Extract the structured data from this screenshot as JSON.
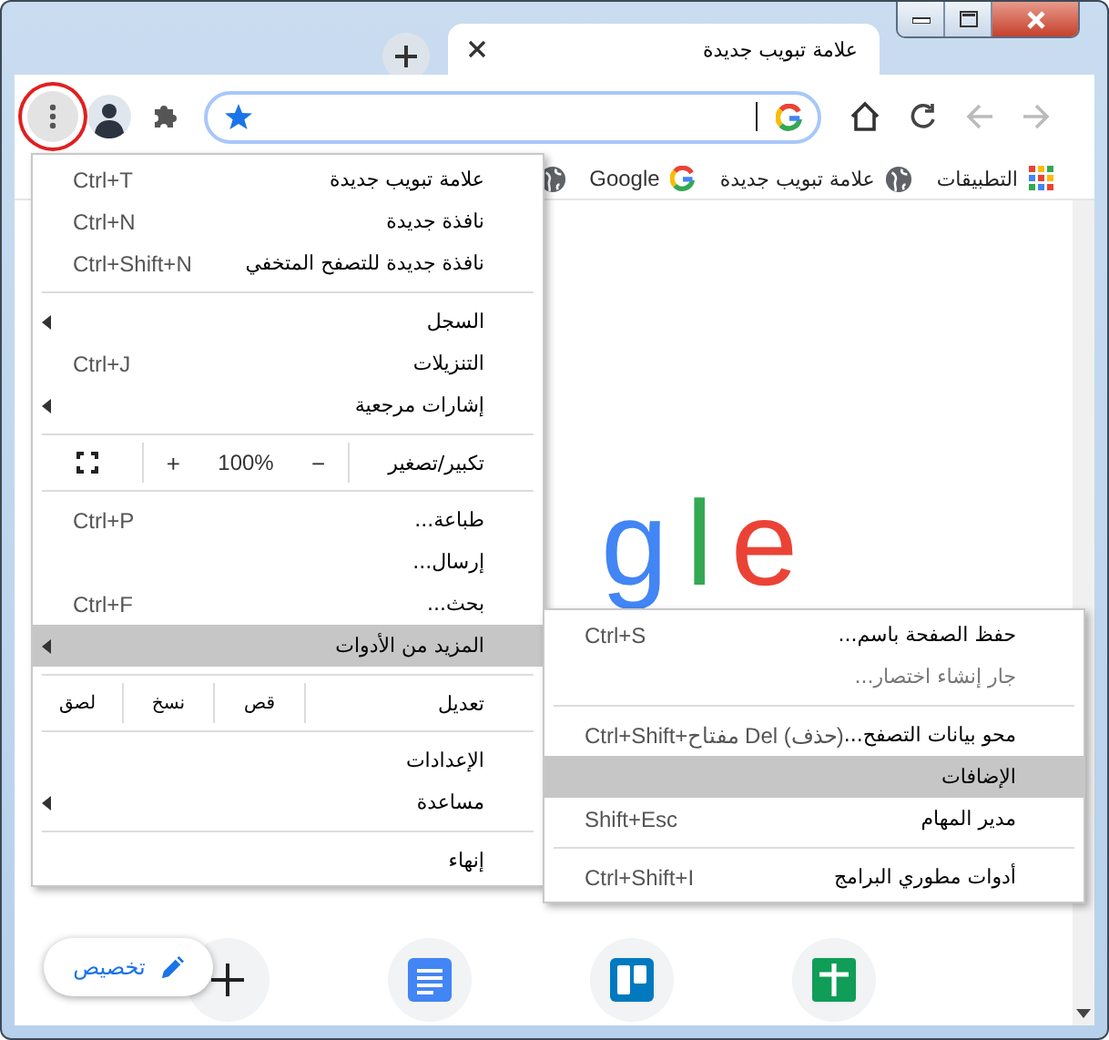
{
  "tabs": [
    {
      "title": "علامة تبويب جديدة",
      "selected": true
    }
  ],
  "toolbar": {
    "menu_button_outlined": true,
    "back_disabled": true,
    "forward_disabled": true
  },
  "bookmarks": [
    {
      "kind": "apps",
      "label": "التطبيقات"
    },
    {
      "kind": "globe",
      "label": "علامة تبويب جديدة"
    },
    {
      "kind": "g",
      "label": "Google"
    },
    {
      "kind": "globe"
    }
  ],
  "logo": {
    "text": "gle"
  },
  "shortcuts": [
    {
      "kind": "add"
    },
    {
      "kind": "docs"
    },
    {
      "kind": "board"
    },
    {
      "kind": "sheet"
    }
  ],
  "customize_button": {
    "label": "تخصيص"
  },
  "main_menu": {
    "items": [
      {
        "kind": "item",
        "label": "علامة تبويب جديدة",
        "shortcut": "Ctrl+T",
        "submenu": false,
        "selected": false
      },
      {
        "kind": "item",
        "label": "نافذة جديدة",
        "shortcut": "Ctrl+N",
        "submenu": false,
        "selected": false
      },
      {
        "kind": "item",
        "label": "نافذة جديدة للتصفح المتخفي",
        "shortcut": "Ctrl+Shift+N",
        "submenu": false,
        "selected": false
      },
      {
        "kind": "separator"
      },
      {
        "kind": "item",
        "label": "السجل",
        "submenu": true,
        "selected": false
      },
      {
        "kind": "item",
        "label": "التنزيلات",
        "shortcut": "Ctrl+J",
        "submenu": false,
        "selected": false
      },
      {
        "kind": "item",
        "label": "إشارات مرجعية",
        "submenu": true,
        "selected": false
      },
      {
        "kind": "separator"
      },
      {
        "kind": "zoom",
        "label": "تكبير/تصغير",
        "minus": "−",
        "value": "100%",
        "plus": "+"
      },
      {
        "kind": "separator"
      },
      {
        "kind": "item",
        "label": "طباعة...",
        "shortcut": "Ctrl+P",
        "submenu": false,
        "selected": false
      },
      {
        "kind": "item",
        "label": "إرسال...",
        "submenu": false,
        "selected": false
      },
      {
        "kind": "item",
        "label": "بحث...",
        "shortcut": "Ctrl+F",
        "submenu": false,
        "selected": false
      },
      {
        "kind": "item",
        "label": "المزيد من الأدوات",
        "submenu": true,
        "selected": true
      },
      {
        "kind": "separator"
      },
      {
        "kind": "edit",
        "label": "تعديل",
        "actions": [
          "قص",
          "نسخ",
          "لصق"
        ]
      },
      {
        "kind": "separator"
      },
      {
        "kind": "item",
        "label": "الإعدادات",
        "submenu": false,
        "selected": false
      },
      {
        "kind": "item",
        "label": "مساعدة",
        "submenu": true,
        "selected": false
      },
      {
        "kind": "separator"
      },
      {
        "kind": "item",
        "label": "إنهاء",
        "submenu": false,
        "selected": false
      }
    ]
  },
  "submenu": {
    "items": [
      {
        "kind": "item",
        "label": "حفظ الصفحة باسم...",
        "shortcut": "Ctrl+S",
        "disabled": false,
        "selected": false
      },
      {
        "kind": "item",
        "label": "جار إنشاء اختصار...",
        "disabled": true,
        "selected": false
      },
      {
        "kind": "separator"
      },
      {
        "kind": "item",
        "label": "محو بيانات التصفح...",
        "shortcut": "Ctrl+Shift+مفتاح Del (حذف)",
        "disabled": false,
        "selected": false
      },
      {
        "kind": "item",
        "label": "الإضافات",
        "disabled": false,
        "selected": true
      },
      {
        "kind": "item",
        "label": "مدير المهام",
        "shortcut": "Shift+Esc",
        "disabled": false,
        "selected": false
      },
      {
        "kind": "separator"
      },
      {
        "kind": "item",
        "label": "أدوات مطوري البرامج",
        "shortcut": "Ctrl+Shift+I",
        "disabled": false,
        "selected": false
      }
    ]
  }
}
